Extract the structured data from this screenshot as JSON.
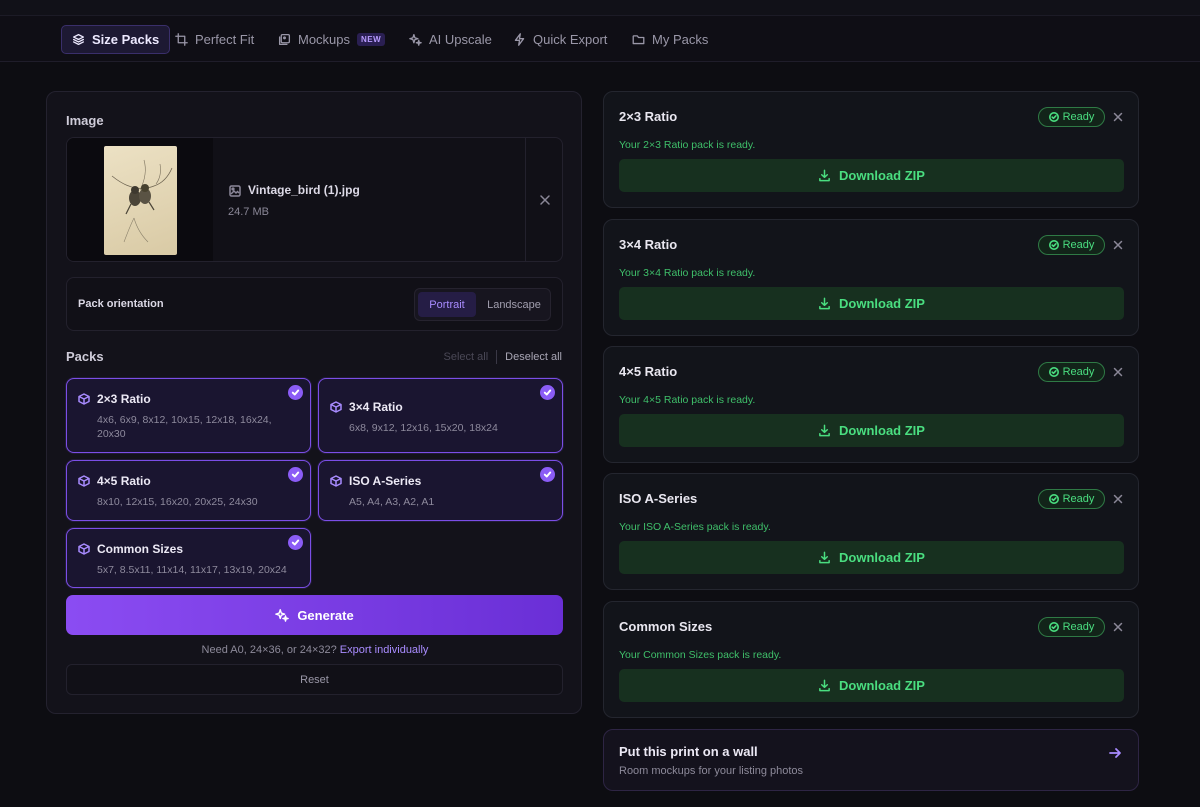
{
  "nav": {
    "tabs": [
      {
        "label": "Size Packs",
        "icon": "layers-icon",
        "active": true
      },
      {
        "label": "Perfect Fit",
        "icon": "crop-icon",
        "active": false
      },
      {
        "label": "Mockups",
        "icon": "image-stack-icon",
        "active": false,
        "badge": "NEW"
      },
      {
        "label": "AI Upscale",
        "icon": "sparkles-icon",
        "active": false
      },
      {
        "label": "Quick Export",
        "icon": "bolt-icon",
        "active": false
      },
      {
        "label": "My Packs",
        "icon": "folder-icon",
        "active": false
      }
    ]
  },
  "left": {
    "image_title": "Image",
    "file": {
      "name": "Vintage_bird (1).jpg",
      "size": "24.7 MB"
    },
    "orientation": {
      "label": "Pack orientation",
      "options": [
        "Portrait",
        "Landscape"
      ],
      "selected": "Portrait"
    },
    "packs_title": "Packs",
    "select_all": "Select all",
    "deselect_all": "Deselect all",
    "packs": [
      {
        "name": "2×3 Ratio",
        "sizes": "4x6, 6x9, 8x12, 10x15, 12x18, 16x24, 20x30",
        "selected": true
      },
      {
        "name": "3×4 Ratio",
        "sizes": "6x8, 9x12, 12x16, 15x20, 18x24",
        "selected": true
      },
      {
        "name": "4×5 Ratio",
        "sizes": "8x10, 12x15, 16x20, 20x25, 24x30",
        "selected": true
      },
      {
        "name": "ISO A-Series",
        "sizes": "A5, A4, A3, A2, A1",
        "selected": true
      },
      {
        "name": "Common Sizes",
        "sizes": "5x7, 8.5x11, 11x14, 11x17, 13x19, 20x24",
        "selected": true
      }
    ],
    "generate_label": "Generate",
    "need_text": "Need A0, 24×36, or 24×32?",
    "export_link": "Export individually",
    "reset_label": "Reset"
  },
  "results": [
    {
      "title": "2×3 Ratio",
      "status": "Ready",
      "message": "Your 2×3 Ratio pack is ready.",
      "download": "Download ZIP"
    },
    {
      "title": "3×4 Ratio",
      "status": "Ready",
      "message": "Your 3×4 Ratio pack is ready.",
      "download": "Download ZIP"
    },
    {
      "title": "4×5 Ratio",
      "status": "Ready",
      "message": "Your 4×5 Ratio pack is ready.",
      "download": "Download ZIP"
    },
    {
      "title": "ISO A-Series",
      "status": "Ready",
      "message": "Your ISO A-Series pack is ready.",
      "download": "Download ZIP"
    },
    {
      "title": "Common Sizes",
      "status": "Ready",
      "message": "Your Common Sizes pack is ready.",
      "download": "Download ZIP"
    }
  ],
  "wall_promo": {
    "title": "Put this print on a wall",
    "subtitle": "Room mockups for your listing photos"
  },
  "colors": {
    "accent": "#8b5cf6",
    "success": "#4ade80",
    "background": "#0d0d12"
  }
}
